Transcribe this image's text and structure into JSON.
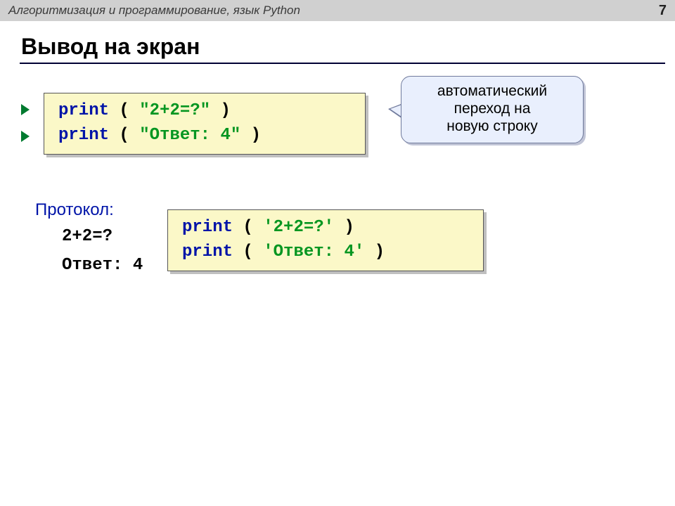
{
  "header": {
    "subtitle": "Алгоритмизация и программирование, язык Python",
    "page_number": "7"
  },
  "title": "Вывод на экран",
  "callout": {
    "line1": "автоматический",
    "line2": "переход на",
    "line3": "новую строку"
  },
  "code1": {
    "l1_kw": "print",
    "l1_open": " ( ",
    "l1_str": "\"2+2=?\"",
    "l1_close": " )",
    "l2_kw": "print",
    "l2_open": " ( ",
    "l2_str": "\"Ответ: 4\"",
    "l2_close": " )"
  },
  "protocol": {
    "label": "Протокол:",
    "line1": "2+2=?",
    "line2": "Ответ: 4"
  },
  "code2": {
    "l1_kw": "print",
    "l1_open": " ( ",
    "l1_str": "'2+2=?'",
    "l1_close": " )",
    "l2_kw": "print",
    "l2_open": " ( ",
    "l2_str": "'Ответ: 4'",
    "l2_close": " )"
  }
}
